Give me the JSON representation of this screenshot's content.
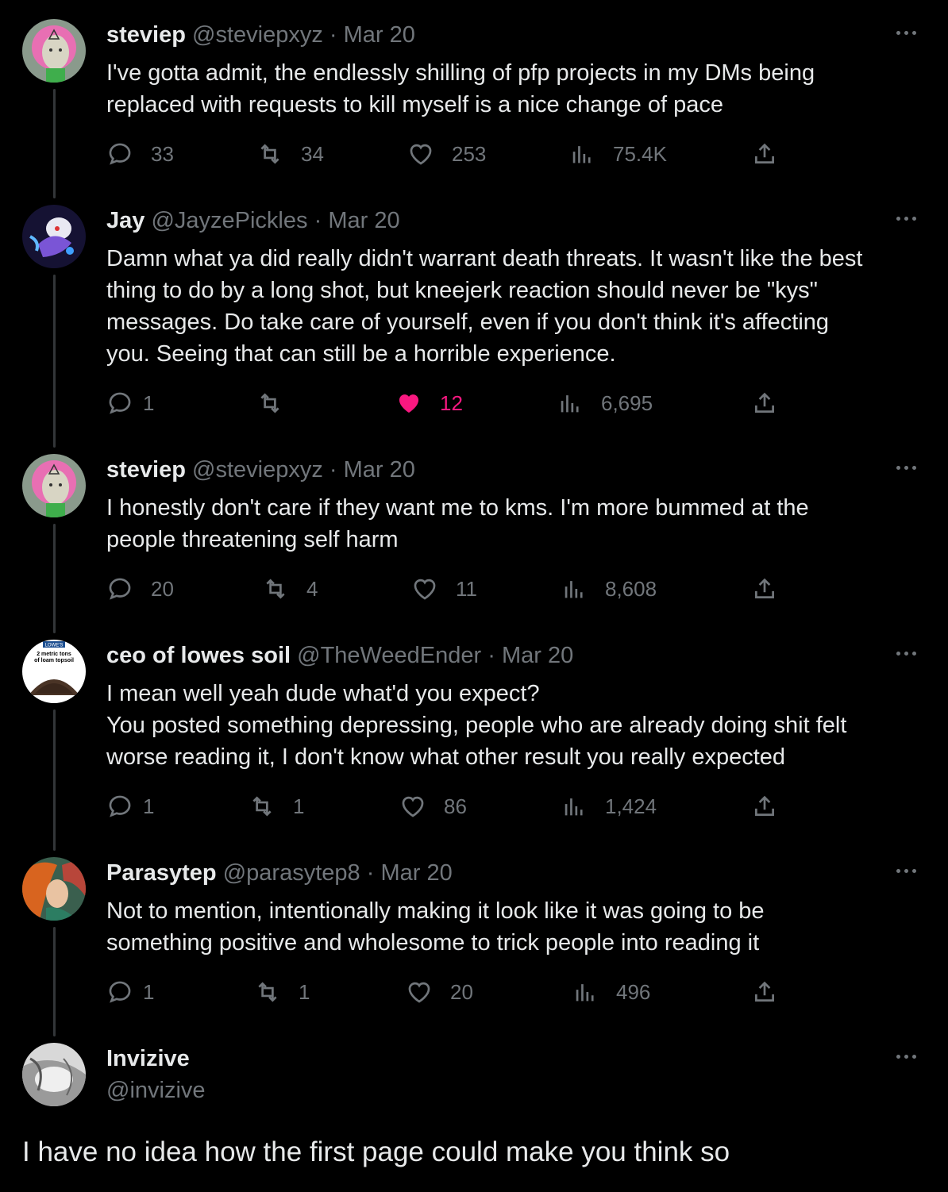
{
  "tweets": [
    {
      "name": "steviep",
      "handle": "@steviepxyz",
      "date": "Mar 20",
      "text": "I've gotta admit, the endlessly shilling of pfp projects in my DMs being\nreplaced with requests to kill myself is a nice change of pace",
      "replies": "33",
      "retweets": "34",
      "likes": "253",
      "views": "75.4K",
      "liked": false
    },
    {
      "name": "Jay",
      "handle": "@JayzePickles",
      "date": "Mar 20",
      "text": "Damn what ya did really didn't warrant death threats. It wasn't like the best\nthing to do by a long shot, but kneejerk reaction should never be \"kys\"\nmessages. Do take care of yourself, even if you don't think it's affecting\nyou. Seeing that can still be a horrible experience.",
      "replies": "1",
      "retweets": "",
      "likes": "12",
      "views": "6,695",
      "liked": true
    },
    {
      "name": "steviep",
      "handle": "@steviepxyz",
      "date": "Mar 20",
      "text": "I honestly don't care if they want me to kms. I'm more bummed at the\npeople threatening self harm",
      "replies": "20",
      "retweets": "4",
      "likes": "11",
      "views": "8,608",
      "liked": false
    },
    {
      "name": "ceo of lowes soil",
      "handle": "@TheWeedEnder",
      "date": "Mar 20",
      "text": "I mean well yeah dude what'd you expect?\nYou posted something depressing, people who are already doing shit felt\nworse reading it, I don't know what other result you really expected",
      "replies": "1",
      "retweets": "1",
      "likes": "86",
      "views": "1,424",
      "liked": false,
      "avatar_text": [
        "LOWE'S",
        "2 metric tons",
        "of loam topsoil"
      ]
    },
    {
      "name": "Parasytep",
      "handle": "@parasytep8",
      "date": "Mar 20",
      "text": "Not to mention, intentionally making it look like it was going to be\nsomething positive and wholesome to trick people into reading it",
      "replies": "1",
      "retweets": "1",
      "likes": "20",
      "views": "496",
      "liked": false
    }
  ],
  "focus_tweet": {
    "name": "Invizive",
    "handle": "@invizive",
    "text": "I have no idea how the first page could make you think so"
  },
  "colors": {
    "background": "#000000",
    "text": "#e7e9ea",
    "muted": "#71767b",
    "like": "#f91880",
    "thread_line": "#333639"
  }
}
